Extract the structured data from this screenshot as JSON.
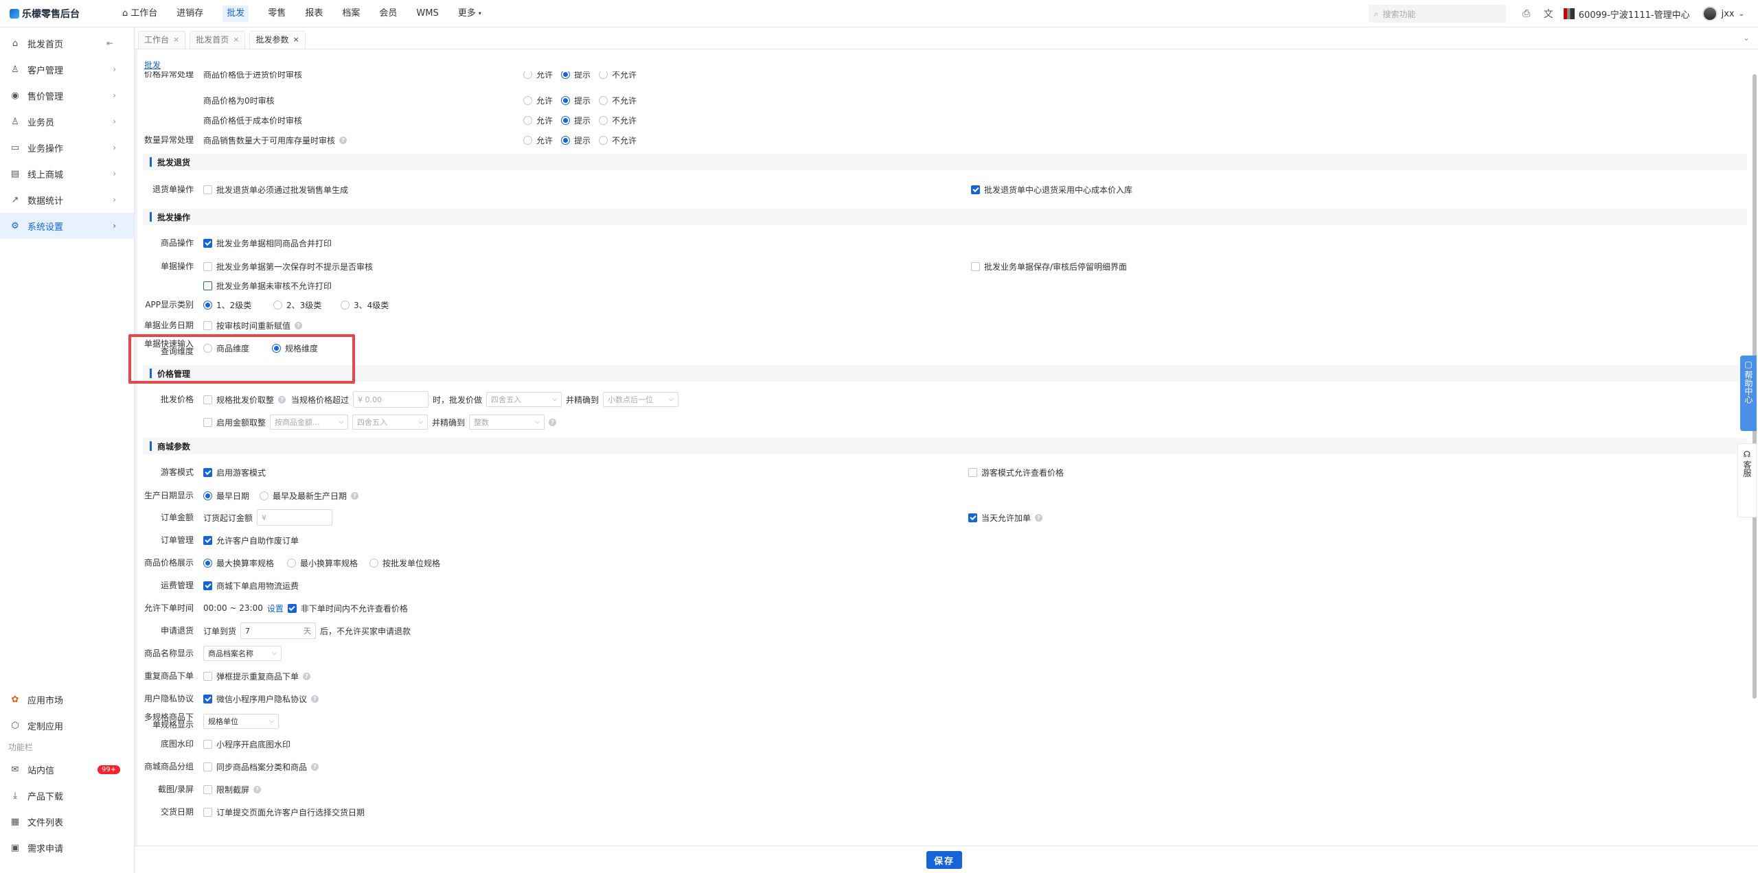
{
  "app": {
    "title": "乐檬零售后台"
  },
  "nav": {
    "items": [
      "工作台",
      "进销存",
      "批发",
      "零售",
      "报表",
      "档案",
      "会员",
      "WMS",
      "更多"
    ],
    "active_index": 2
  },
  "topbar": {
    "search_placeholder": "搜索功能",
    "store_label": "60099-宁波1111-管理中心",
    "user_name": "jxx"
  },
  "sidebar": {
    "items": [
      {
        "label": "批发首页",
        "icon": "home-icon"
      },
      {
        "label": "客户管理",
        "icon": "customer-icon"
      },
      {
        "label": "售价管理",
        "icon": "price-icon"
      },
      {
        "label": "业务员",
        "icon": "person-icon"
      },
      {
        "label": "业务操作",
        "icon": "operation-icon"
      },
      {
        "label": "线上商城",
        "icon": "shop-icon"
      },
      {
        "label": "数据统计",
        "icon": "chart-icon"
      },
      {
        "label": "系统设置",
        "icon": "settings-icon"
      }
    ],
    "active_index": 7,
    "bottom_items": [
      {
        "label": "应用市场",
        "icon": "app-market-icon"
      },
      {
        "label": "定制应用",
        "icon": "custom-app-icon"
      }
    ],
    "function_section_label": "功能栏",
    "function_items": [
      {
        "label": "站内信",
        "icon": "message-icon",
        "badge": "99+"
      },
      {
        "label": "产品下载",
        "icon": "download-icon"
      },
      {
        "label": "文件列表",
        "icon": "file-list-icon"
      },
      {
        "label": "需求申请",
        "icon": "request-icon"
      }
    ]
  },
  "tabs": [
    {
      "label": "工作台",
      "active": false
    },
    {
      "label": "批发首页",
      "active": false
    },
    {
      "label": "批发参数",
      "active": true
    }
  ],
  "breadcrumb": "批发",
  "opts": {
    "allow": "允许",
    "prompt": "提示",
    "deny": "不允许"
  },
  "price_abnormal": {
    "label": "价格异常处理",
    "rows": [
      "商品价格低于进货价时审核",
      "商品价格为0时审核",
      "商品价格低于成本价时审核"
    ]
  },
  "qty_abnormal": {
    "label": "数量异常处理",
    "row": "商品销售数量大于可用库存量时审核"
  },
  "sections": {
    "return": "批发退货",
    "operation": "批发操作",
    "price_mgmt": "价格管理",
    "mall": "商城参数"
  },
  "return_op": {
    "label": "退货单操作",
    "opt1": "批发退货单必须通过批发销售单生成",
    "opt2": "批发退货单中心退货采用中心成本价入库"
  },
  "operation": {
    "product_label": "商品操作",
    "product_opt": "批发业务单据相同商品合并打印",
    "doc_label": "单据操作",
    "doc_opt1": "批发业务单据第一次保存时不提示是否审核",
    "doc_opt2": "批发业务单据保存/审核后停留明细界面",
    "doc_opt3": "批发业务单据未审核不允许打印",
    "app_label": "APP显示类别",
    "app_opts": [
      "1、2级类",
      "2、3级类",
      "3、4级类"
    ],
    "date_label": "单据业务日期",
    "date_opt": "按审核时间重新赋值",
    "quick_label_1": "单据快速输入",
    "quick_label_2": "查询维度",
    "quick_opts": [
      "商品维度",
      "规格维度"
    ]
  },
  "price_mgmt": {
    "label": "批发价格",
    "opt1": "规格批发价取整",
    "when_exceeds": "当规格价格超过",
    "amount_placeholder": "0.00",
    "currency": "¥",
    "when_price": "时，批发价做",
    "round_placeholder": "四舍五入",
    "precise_to": "并精确到",
    "decimal_placeholder": "小数点后一位",
    "opt2": "启用金额取整",
    "by_amount_placeholder": "按商品金额...",
    "round2_placeholder": "四舍五入",
    "precise_to2": "并精确到",
    "integer_placeholder": "整数"
  },
  "mall": {
    "guest_label": "游客模式",
    "guest_opt": "启用游客模式",
    "guest_price_opt": "游客模式允许查看价格",
    "prod_date_label": "生产日期显示",
    "prod_date_opts": [
      "最早日期",
      "最早及最新生产日期"
    ],
    "order_amount_label": "订单金额",
    "order_min_label": "订货起订金额",
    "order_min_placeholder": "¥",
    "same_day_opt": "当天允许加单",
    "order_mgmt_label": "订单管理",
    "order_mgmt_opt": "允许客户自助作废订单",
    "price_display_label": "商品价格展示",
    "price_display_opts": [
      "最大换算率规格",
      "最小换算率规格",
      "按批发单位规格"
    ],
    "freight_label": "运费管理",
    "freight_opt": "商城下单启用物流运费",
    "order_time_label": "允许下单时间",
    "order_time_value": "00:00 ~ 23:00",
    "order_time_set": "设置",
    "order_time_opt": "非下单时间内不允许查看价格",
    "refund_label": "申请退货",
    "refund_prefix": "订单到货",
    "refund_days": "7",
    "refund_unit": "天",
    "refund_suffix": "后，不允许买家申请退款",
    "name_display_label": "商品名称显示",
    "name_display_value": "商品档案名称",
    "dup_label": "重复商品下单",
    "dup_opt": "弹框提示重复商品下单",
    "privacy_label": "用户隐私协议",
    "privacy_opt": "微信小程序用户隐私协议",
    "multi_spec_label_1": "多规格商品下",
    "multi_spec_label_2": "单规格显示",
    "multi_spec_value": "规格单位",
    "watermark_label": "底图水印",
    "watermark_opt": "小程序开启底图水印",
    "group_label": "商城商品分组",
    "group_opt": "同步商品档案分类和商品",
    "screenshot_label": "截图/录屏",
    "screenshot_opt": "限制截屏",
    "delivery_label": "交货日期",
    "delivery_opt": "订单提交页面允许客户自行选择交货日期"
  },
  "buttons": {
    "save": "保存"
  },
  "float": {
    "help_center": "帮助中心",
    "customer_service": "客服"
  },
  "colors": {
    "primary": "#1565d8",
    "highlight_box": "#ef4444"
  }
}
